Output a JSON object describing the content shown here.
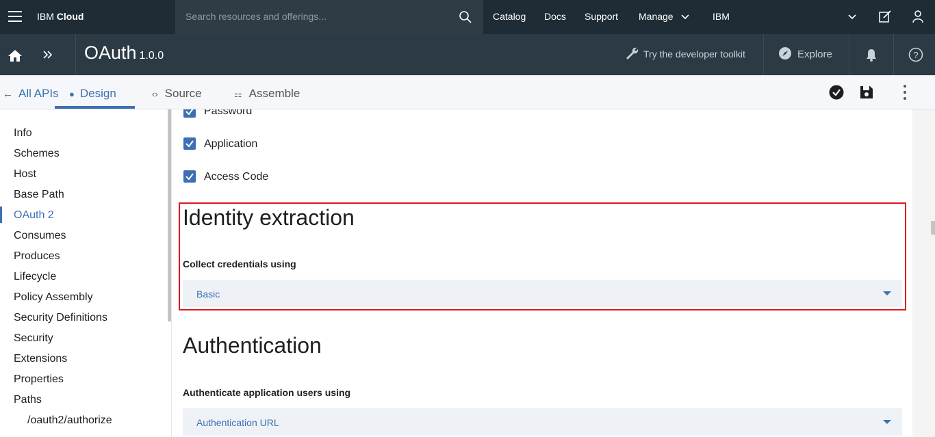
{
  "topbar": {
    "brand_prefix": "IBM",
    "brand_bold": "Cloud",
    "search_placeholder": "Search resources and offerings...",
    "nav": [
      "Catalog",
      "Docs",
      "Support",
      "Manage",
      "IBM"
    ]
  },
  "subbar": {
    "api_name": "OAuth",
    "api_version": "1.0.0",
    "toolkit_label": "Try the developer toolkit",
    "explore_label": "Explore"
  },
  "tabs": {
    "back_label": "All APIs",
    "design": "Design",
    "source": "Source",
    "assemble": "Assemble"
  },
  "sidebar": {
    "items": [
      "Info",
      "Schemes",
      "Host",
      "Base Path",
      "OAuth 2",
      "Consumes",
      "Produces",
      "Lifecycle",
      "Policy Assembly",
      "Security Definitions",
      "Security",
      "Extensions",
      "Properties",
      "Paths",
      "/oauth2/authorize"
    ]
  },
  "content": {
    "checkboxes": [
      "Password",
      "Application",
      "Access Code"
    ],
    "identity": {
      "heading": "Identity extraction",
      "label": "Collect credentials using",
      "value": "Basic"
    },
    "authentication": {
      "heading": "Authentication",
      "label": "Authenticate application users using",
      "value": "Authentication URL"
    }
  },
  "colors": {
    "accent": "#3d70b2",
    "highlight": "#e0141e",
    "topbar": "#1f2c35"
  }
}
